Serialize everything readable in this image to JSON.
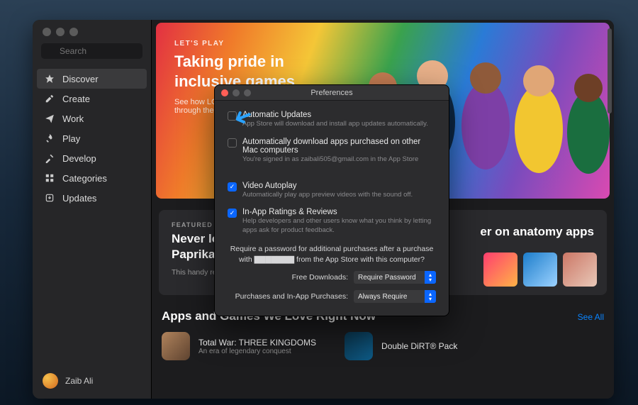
{
  "sidebar": {
    "search_placeholder": "Search",
    "items": [
      {
        "label": "Discover"
      },
      {
        "label": "Create"
      },
      {
        "label": "Work"
      },
      {
        "label": "Play"
      },
      {
        "label": "Develop"
      },
      {
        "label": "Categories"
      },
      {
        "label": "Updates"
      }
    ],
    "user_name": "Zaib Ali"
  },
  "hero": {
    "kicker": "LET'S PLAY",
    "title": "Taking pride in inclusive games",
    "subtitle": "See how LGBTQ+ stories will download through these storylines"
  },
  "cards": {
    "left": {
      "kicker": "FEATURED APP",
      "title": "Never lose grandma's recipe with Paprika",
      "body": "This handy recipe manager really gets you cooking."
    },
    "right": {
      "title": "er on anatomy apps"
    }
  },
  "section": {
    "title": "Apps and Games We Love Right Now",
    "see_all": "See All",
    "apps": [
      {
        "name": "Total War: THREE KINGDOMS",
        "sub": "An era of legendary conquest"
      },
      {
        "name": "Double DiRT® Pack",
        "sub": ""
      }
    ]
  },
  "prefs": {
    "title": "Preferences",
    "opts": [
      {
        "label": "Automatic Updates",
        "desc": "App Store will download and install app updates automatically."
      },
      {
        "label": "Automatically download apps purchased on other Mac computers",
        "desc": "You're signed in as zaibali505@gmail.com in the App Store"
      },
      {
        "label": "Video Autoplay",
        "desc": "Automatically play app preview videos with the sound off."
      },
      {
        "label": "In-App Ratings & Reviews",
        "desc": "Help developers and other users know what you think by letting apps ask for product feedback."
      }
    ],
    "pwd_head": "Require a password for additional purchases after a purchase with ▇▇▇▇▇▇▇ from the App Store with this computer?",
    "rows": [
      {
        "label": "Free Downloads:",
        "value": "Require Password"
      },
      {
        "label": "Purchases and In-App Purchases:",
        "value": "Always Require"
      }
    ]
  }
}
